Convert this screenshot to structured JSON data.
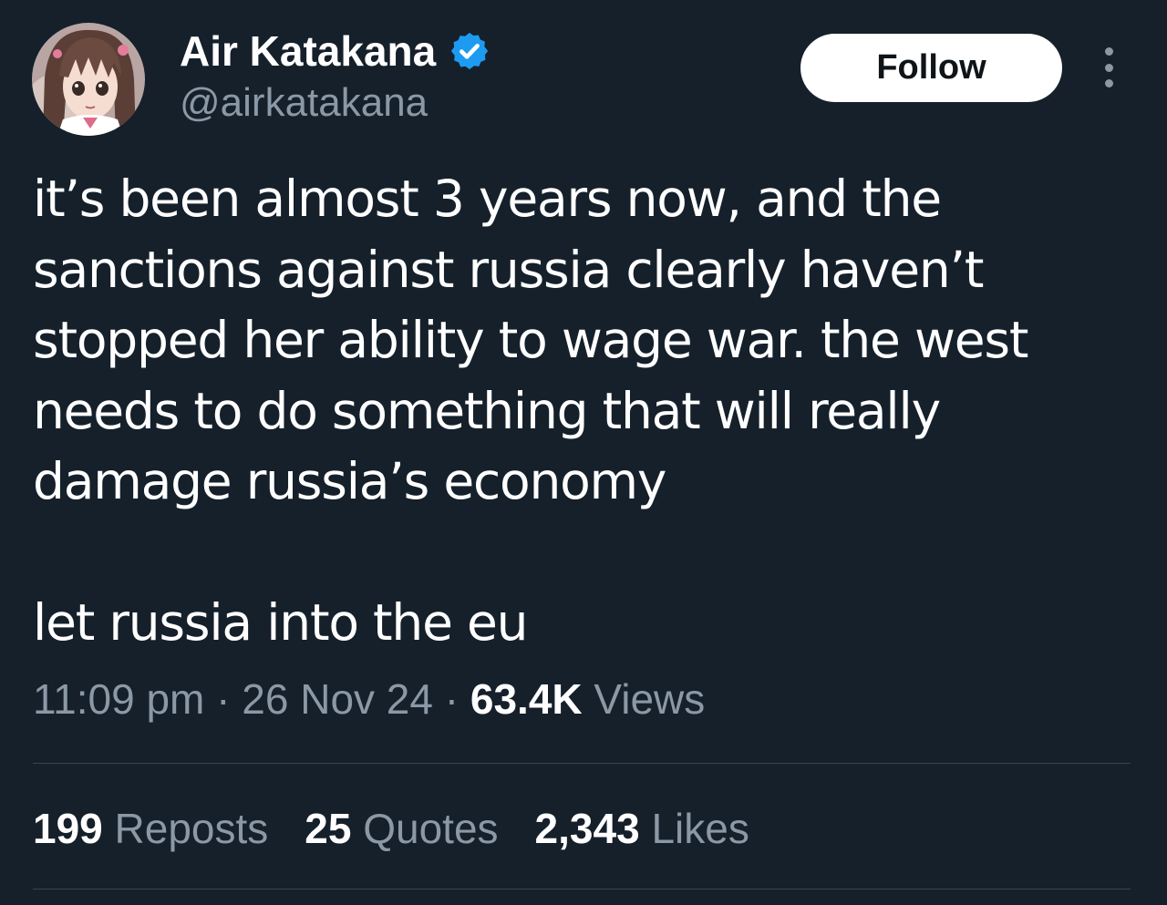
{
  "author": {
    "display_name": "Air Katakana",
    "handle": "@airkatakana",
    "verified": true,
    "avatar_icon": "anime-girl-avatar"
  },
  "follow_label": "Follow",
  "more_icon": "more-vertical-icon",
  "tweet": {
    "lines": [
      "it’s been almost 3 years now, and the",
      "sanctions against russia clearly haven’t",
      "stopped her ability to wage war. the west",
      "needs to do something that will really",
      "damage russia’s economy"
    ],
    "punchline": "let russia into the eu"
  },
  "meta": {
    "time": "11:09 pm",
    "separator": " · ",
    "date": "26 Nov 24",
    "views_count": "63.4K",
    "views_label": "Views"
  },
  "stats": {
    "reposts_count": "199",
    "reposts_label": "Reposts",
    "quotes_count": "25",
    "quotes_label": "Quotes",
    "likes_count": "2,343",
    "likes_label": "Likes"
  },
  "colors": {
    "background": "#15202b",
    "secondary_text": "#8b98a5",
    "verified_badge": "#1d9bf0",
    "divider": "#38444d"
  }
}
